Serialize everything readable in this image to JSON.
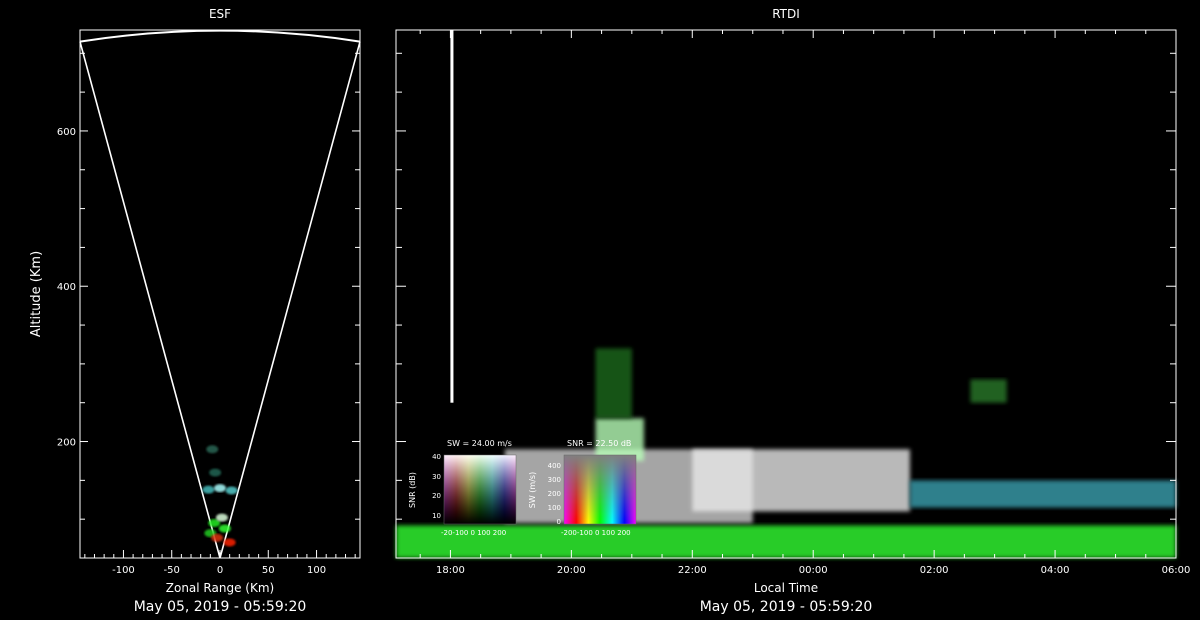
{
  "chart_data": [
    {
      "type": "scatter",
      "title": "ESF",
      "xlabel": "Zonal Range (Km)",
      "ylabel": "Altitude (Km)",
      "xlim": [
        -145,
        145
      ],
      "ylim": [
        50,
        730
      ],
      "x_ticks": [
        -100,
        -50,
        0,
        50,
        100
      ],
      "y_ticks": [
        200,
        400,
        600
      ],
      "fan_edges": {
        "left_x": -145,
        "right_x": 145,
        "top_altitude": 715,
        "apex_altitude": 50
      },
      "echo_clusters": [
        {
          "x": -10,
          "y": 82,
          "color": "#22cc22"
        },
        {
          "x": -3,
          "y": 76,
          "color": "#dd3311"
        },
        {
          "x": 5,
          "y": 88,
          "color": "#33ff33"
        },
        {
          "x": 10,
          "y": 70,
          "color": "#ff2200"
        },
        {
          "x": -6,
          "y": 95,
          "color": "#22ee22"
        },
        {
          "x": 2,
          "y": 102,
          "color": "#ddffdd"
        },
        {
          "x": -12,
          "y": 138,
          "color": "#44bbbb"
        },
        {
          "x": 0,
          "y": 140,
          "color": "#aaffff"
        },
        {
          "x": 12,
          "y": 137,
          "color": "#55cccc"
        },
        {
          "x": -5,
          "y": 160,
          "color": "#226655"
        },
        {
          "x": -8,
          "y": 190,
          "color": "#2a6655"
        }
      ],
      "footer": "May 05, 2019 - 05:59:20"
    },
    {
      "type": "heatmap",
      "title": "RTDI",
      "xlabel": "Local Time",
      "ylabel": "",
      "x_ticks": [
        "18:00",
        "20:00",
        "22:00",
        "00:00",
        "02:00",
        "04:00",
        "06:00"
      ],
      "x_range_hours": [
        17.1,
        30.0
      ],
      "ylim": [
        50,
        730
      ],
      "y_ticks": [
        200,
        400,
        600
      ],
      "features": [
        {
          "label": "",
          "t_start": 18.0,
          "t_end": 18.05,
          "alt_low": 250,
          "alt_high": 730,
          "color": "#ffffff"
        },
        {
          "label": "",
          "t_start": 17.1,
          "t_end": 30.0,
          "alt_low": 50,
          "alt_high": 92,
          "color": "#33ff33"
        },
        {
          "label": "",
          "t_start": 18.9,
          "t_end": 23.0,
          "alt_low": 95,
          "alt_high": 190,
          "color": "#cfcfcf"
        },
        {
          "label": "",
          "t_start": 22.0,
          "t_end": 25.6,
          "alt_low": 110,
          "alt_high": 190,
          "color": "#e8e8e8"
        },
        {
          "label": "",
          "t_start": 25.6,
          "t_end": 30.0,
          "alt_low": 115,
          "alt_high": 150,
          "color": "#3aa0b0"
        },
        {
          "label": "",
          "t_start": 20.4,
          "t_end": 21.2,
          "alt_low": 175,
          "alt_high": 230,
          "color": "#b8ffb8"
        },
        {
          "label": "",
          "t_start": 20.4,
          "t_end": 21.0,
          "alt_low": 230,
          "alt_high": 320,
          "color": "#1f6a1f"
        },
        {
          "label": "",
          "t_start": 26.6,
          "t_end": 27.2,
          "alt_low": 250,
          "alt_high": 280,
          "color": "#2a7a2a"
        }
      ],
      "legends": [
        {
          "label": "SW = 24.00 m/s",
          "ylabel": "SNR (dB)",
          "y_ticks": [
            "10",
            "20",
            "30",
            "40"
          ],
          "x_ticks_text": "-20-100 0 100 200"
        },
        {
          "label": "SNR = 22.50 dB",
          "ylabel": "SW (m/s)",
          "y_ticks": [
            "0",
            "100",
            "200",
            "300",
            "400"
          ],
          "x_ticks_text": "-200-100 0 100 200"
        }
      ],
      "footer": "May 05, 2019 - 05:59:20"
    }
  ]
}
